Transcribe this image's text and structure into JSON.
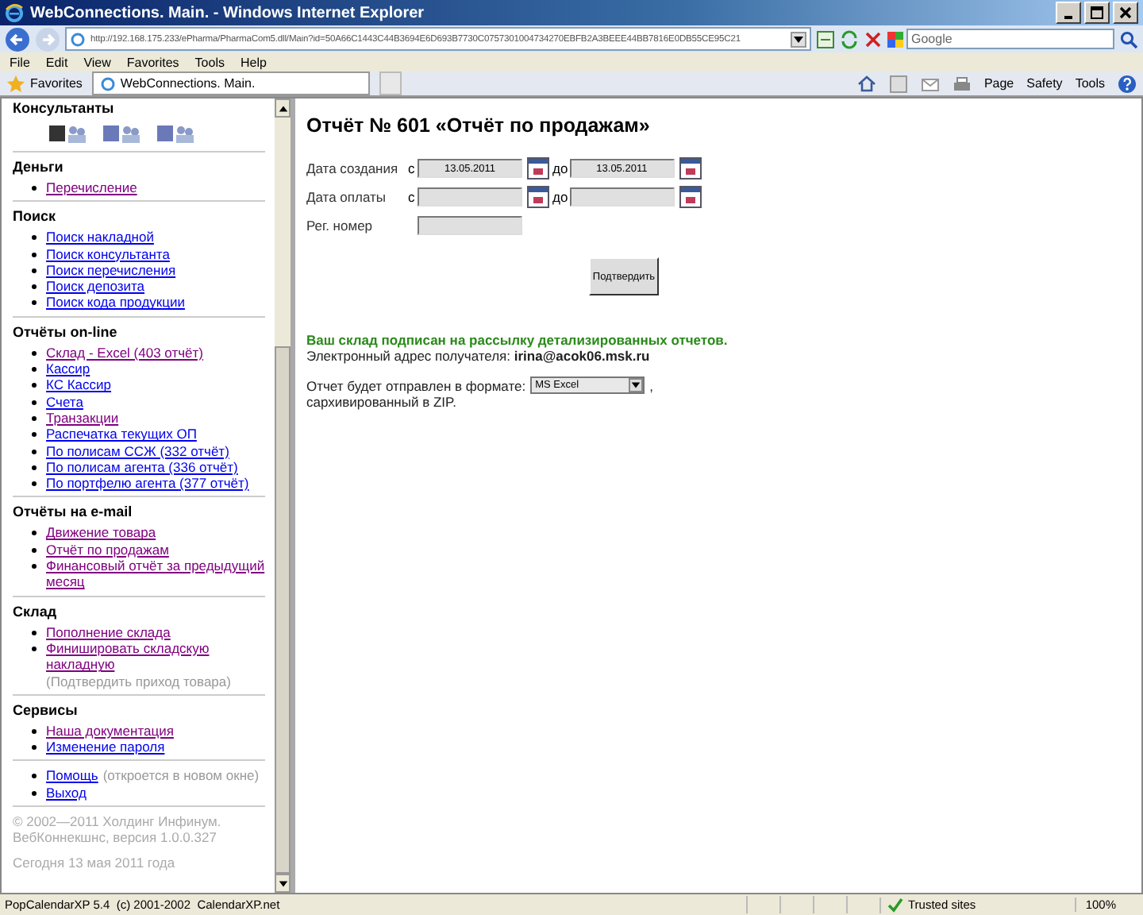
{
  "window": {
    "title": "WebConnections. Main. - Windows Internet Explorer"
  },
  "address_bar": {
    "url": "http://192.168.175.233/ePharma/PharmaCom5.dll/Main?id=50A66C1443C44B3694E6D693B7730C0757301004734270EBFB2A3BEEE44BB7816E0DB55CE95C21"
  },
  "search": {
    "placeholder": "Google"
  },
  "menu": [
    "File",
    "Edit",
    "View",
    "Favorites",
    "Tools",
    "Help"
  ],
  "favorites_button": "Favorites",
  "tab": {
    "title": "WebConnections. Main."
  },
  "command_bar": [
    "Page",
    "Safety",
    "Tools"
  ],
  "sidebar": {
    "consultants_title": "Консультанты",
    "sections": [
      {
        "title": "Деньги",
        "links": [
          {
            "text": "Перечисление",
            "visited": true
          }
        ]
      },
      {
        "title": "Поиск",
        "links": [
          {
            "text": "Поиск накладной",
            "visited": false
          },
          {
            "text": "Поиск консультанта",
            "visited": false
          },
          {
            "text": "Поиск перечисления",
            "visited": false
          },
          {
            "text": "Поиск депозита",
            "visited": false
          },
          {
            "text": "Поиск кода продукции",
            "visited": false
          }
        ]
      },
      {
        "title": "Отчёты on-line",
        "links": [
          {
            "text": "Склад - Excel (403 отчёт)",
            "visited": true
          },
          {
            "text": "Кассир",
            "visited": false
          },
          {
            "text": "КС Кассир",
            "visited": false
          },
          {
            "text": "Счета",
            "visited": false
          },
          {
            "text": "Транзакции",
            "visited": true
          },
          {
            "text": "Распечатка текущих ОП",
            "visited": false
          },
          {
            "text": "По полисам ССЖ (332 отчёт)",
            "visited": false
          },
          {
            "text": "По полисам агента (336 отчёт)",
            "visited": false
          },
          {
            "text": "По портфелю агента (377 отчёт)",
            "visited": false
          }
        ]
      },
      {
        "title": "Отчёты на e-mail",
        "links": [
          {
            "text": "Движение товара",
            "visited": true
          },
          {
            "text": "Отчёт по продажам",
            "visited": true
          },
          {
            "text": "Финансовый отчёт за предыдущий месяц",
            "visited": true
          }
        ]
      },
      {
        "title": "Склад",
        "links": [
          {
            "text": "Пополнение склада",
            "visited": true
          },
          {
            "text": "Финишировать складскую накладную",
            "visited": true,
            "note": "(Подтвердить приход товара)"
          }
        ]
      },
      {
        "title": "Сервисы",
        "links": [
          {
            "text": "Наша документация",
            "visited": true
          },
          {
            "text": "Изменение пароля",
            "visited": false
          }
        ]
      },
      {
        "links": [
          {
            "text": "Помощь",
            "visited": false,
            "note": "(откроется в новом окне)"
          },
          {
            "text": "Выход",
            "visited": false
          }
        ]
      }
    ],
    "copyright": "© 2002—2011 Холдинг Инфинум. ВебКоннекшнс, версия 1.0.0.327",
    "today": "Сегодня 13 мая 2011 года"
  },
  "report": {
    "title": "Отчёт № 601 «Отчёт по продажам»",
    "rows": [
      {
        "label": "Дата создания",
        "from_label": "с",
        "from": "13.05.2011",
        "to_label": "до",
        "to": "13.05.2011",
        "kind": "range"
      },
      {
        "label": "Дата оплаты",
        "from_label": "с",
        "from": "",
        "to_label": "до",
        "to": "",
        "kind": "range"
      },
      {
        "label": "Рег. номер",
        "from": "",
        "kind": "single"
      }
    ],
    "submit": "Подтвердить",
    "subscription": "Ваш склад подписан на рассылку детализированных отчетов.",
    "recipient": "Электронный адрес получателя: **irina@acok06.msk.ru**",
    "format_prefix": "Отчет будет отправлен в формате:",
    "format": "MS Excel",
    "format_suffix": ",",
    "zip_note": "сархивированный в ZIP."
  },
  "status_bar": {
    "text": "PopCalendarXP 5.4  (c) 2001-2002  CalendarXP.net",
    "zone": "Trusted sites",
    "zoom": "100%"
  }
}
